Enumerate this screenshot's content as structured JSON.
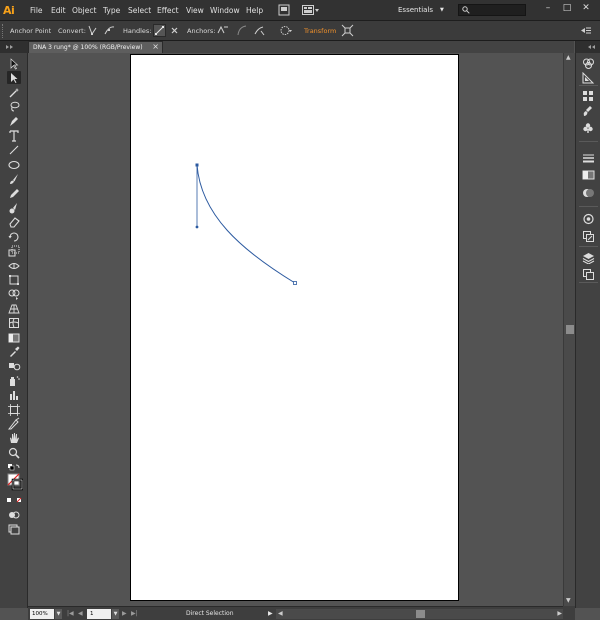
{
  "app": {
    "logo": "Ai"
  },
  "menu": {
    "items": [
      "File",
      "Edit",
      "Object",
      "Type",
      "Select",
      "Effect",
      "View",
      "Window",
      "Help"
    ]
  },
  "workspace": {
    "label": "Essentials"
  },
  "search": {
    "placeholder": ""
  },
  "control_bar": {
    "mode_label": "Anchor Point",
    "convert_label": "Convert:",
    "handles_label": "Handles:",
    "anchors_label": "Anchors:",
    "transform_label": "Transform"
  },
  "document": {
    "tab_title": "DNA 3 rung* @ 100% (RGB/Preview)",
    "close_glyph": "×"
  },
  "status_bar": {
    "zoom": "100%",
    "artboard_number": "1",
    "tool_status": "Direct Selection"
  },
  "colors": {
    "accent": "#f7a11a",
    "transform_link": "#f0912c",
    "path_stroke": "#2c5aa0",
    "anchor_fill": "#2c5aa0"
  },
  "icons": {
    "toolbar": [
      "selection-tool-icon",
      "direct-selection-tool-icon",
      "magic-wand-tool-icon",
      "lasso-tool-icon",
      "pen-tool-icon",
      "type-tool-icon",
      "line-segment-tool-icon",
      "ellipse-tool-icon",
      "paintbrush-tool-icon",
      "pencil-tool-icon",
      "blob-brush-tool-icon",
      "eraser-tool-icon",
      "rotate-tool-icon",
      "scale-tool-icon",
      "width-tool-icon",
      "free-transform-tool-icon",
      "shape-builder-tool-icon",
      "perspective-grid-tool-icon",
      "mesh-tool-icon",
      "gradient-tool-icon",
      "eyedropper-tool-icon",
      "blend-tool-icon",
      "symbol-sprayer-tool-icon",
      "column-graph-tool-icon",
      "artboard-tool-icon",
      "slice-tool-icon",
      "hand-tool-icon",
      "zoom-tool-icon"
    ],
    "right_dock": [
      "color-panel-icon",
      "color-guide-panel-icon",
      "swatches-panel-icon",
      "brushes-panel-icon",
      "symbols-panel-icon",
      "stroke-panel-icon",
      "gradient-panel-icon",
      "transparency-panel-icon",
      "appearance-panel-icon",
      "graphic-styles-panel-icon",
      "layers-panel-icon",
      "artboards-panel-icon"
    ]
  }
}
